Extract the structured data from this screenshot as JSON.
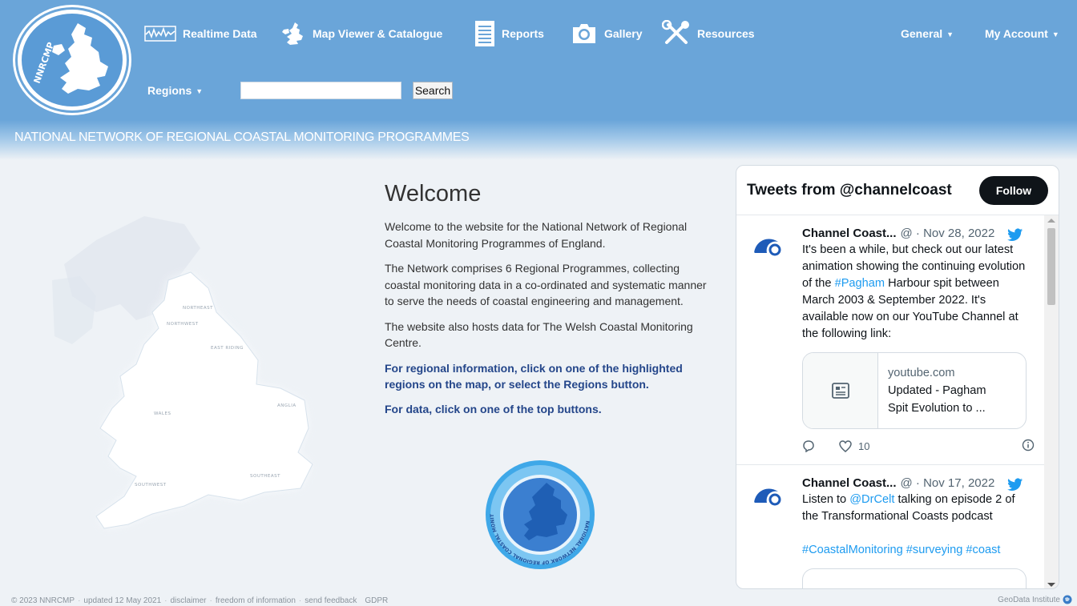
{
  "header": {
    "nav": [
      {
        "label": "Realtime Data",
        "icon": "waveform-icon"
      },
      {
        "label": "Map Viewer & Catalogue",
        "icon": "uk-map-icon"
      },
      {
        "label": "Reports",
        "icon": "document-icon"
      },
      {
        "label": "Gallery",
        "icon": "camera-icon"
      },
      {
        "label": "Resources",
        "icon": "tools-icon"
      }
    ],
    "general_label": "General",
    "account_label": "My Account",
    "regions_label": "Regions",
    "search": {
      "placeholder": "",
      "value": "",
      "button_label": "Search"
    },
    "logo_text": "NNRCMP",
    "tagline": "NATIONAL NETWORK OF REGIONAL COASTAL MONITORING PROGRAMMES"
  },
  "map": {
    "labels": [
      "NORTHEAST",
      "NORTHWEST",
      "EAST RIDING",
      "ANGLIA",
      "WALES",
      "SOUTHEAST",
      "SOUTHWEST"
    ]
  },
  "welcome": {
    "title": "Welcome",
    "p1": "Welcome to the website for the National Network of Regional Coastal Monitoring Programmes of England.",
    "p2": "The Network comprises 6 Regional Programmes, collecting coastal monitoring data in a co-ordinated and systematic manner to serve the needs of coastal engineering and management.",
    "p3": "The website also hosts data for The Welsh Coastal Monitoring Centre.",
    "link1": "For regional information, click on one of the highlighted regions on the map, or select the Regions button.",
    "link2": "For data, click on one of the top buttons.",
    "logo_ring_text": "NATIONAL NETWORK OF REGIONAL COASTAL MONITORING PROGRAMMES"
  },
  "twitter": {
    "title": "Tweets from @channelcoast",
    "follow_label": "Follow",
    "tweets": [
      {
        "name": "Channel Coast...",
        "meta": "@ · Nov 28, 2022",
        "text_before": "It's been a while, but check out our latest animation showing the continuing evolution of the ",
        "hashtag": "#Pagham",
        "text_after": " Harbour spit between March 2003 & September 2022. It's available now on our YouTube Channel at the following link:",
        "card_domain": "youtube.com",
        "card_title_1": "Updated - Pagham",
        "card_title_2": "Spit Evolution to ...",
        "likes": "10"
      },
      {
        "name": "Channel Coast...",
        "meta": "@ · Nov 17, 2022",
        "text_before": "Listen to ",
        "mention": "@DrCelt",
        "text_after": " talking on episode 2 of the Transformational Coasts podcast",
        "hashtags": "#CoastalMonitoring #surveying #coast"
      }
    ]
  },
  "footer": {
    "copyright": "© 2023 NNRCMP",
    "updated": "updated 12 May 2021",
    "disclaimer": "disclaimer",
    "foi": "freedom of information",
    "feedback": "send feedback",
    "gdpr": "GDPR",
    "sep": "·",
    "credit": "GeoData Institute"
  },
  "colors": {
    "header_blue": "#6aa5d9",
    "link_navy": "#24468a",
    "twitter_blue": "#1d9bf0"
  }
}
